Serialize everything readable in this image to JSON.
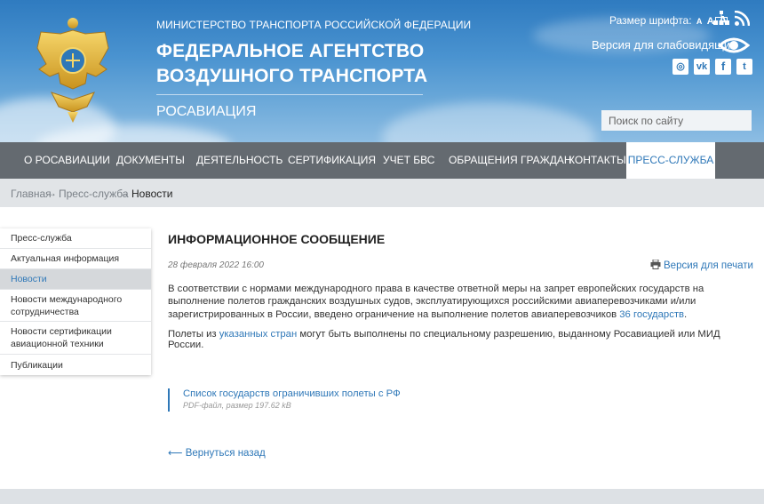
{
  "header": {
    "ministry": "МИНИСТЕРСТВО ТРАНСПОРТА РОССИЙСКОЙ ФЕДЕРАЦИИ",
    "agency_line1": "ФЕДЕРАЛЬНОЕ АГЕНТСТВО",
    "agency_line2": "ВОЗДУШНОГО ТРАНСПОРТА",
    "short_name": "РОСАВИАЦИЯ",
    "font_size_label": "Размер шрифта:",
    "font_size_options": [
      "A",
      "A",
      "A"
    ],
    "blind_version": "Версия для слабовидящих",
    "social": [
      "instagram-icon",
      "vk-icon",
      "facebook-icon",
      "twitter-icon"
    ],
    "search_placeholder": "Поиск по сайту"
  },
  "nav": {
    "items": [
      "О РОСАВИАЦИИ",
      "ДОКУМЕНТЫ",
      "ДЕЯТЕЛЬНОСТЬ",
      "СЕРТИФИКАЦИЯ",
      "УЧЕТ БВС",
      "ОБРАЩЕНИЯ ГРАЖДАН",
      "КОНТАКТЫ",
      "ПРЕСС-СЛУЖБА"
    ],
    "active": "ПРЕСС-СЛУЖБА"
  },
  "breadcrumb": {
    "items": [
      "Главная",
      "Пресс-служба",
      "Новости"
    ],
    "separator": "→"
  },
  "sidebar": {
    "items": [
      "Пресс-служба",
      "Актуальная информация",
      "Новости",
      "Новости международного сотрудничества",
      "Новости сертификации авиационной техники",
      "Публикации"
    ],
    "active": "Новости"
  },
  "article": {
    "title": "ИНФОРМАЦИОННОЕ СООБЩЕНИЕ",
    "date": "28 февраля 2022 16:00",
    "print_label": "Версия для печати",
    "p1_text": "В соответствии с нормами международного права в качестве ответной меры на запрет европейских государств на выполнение полетов гражданских воздушных судов, эксплуатирующихся российскими авиаперевозчиками и/или зарегистрированных в России, введено ограничение на выполнение полетов авиаперевозчиков ",
    "p1_link": "36 государств",
    "p1_end": ".",
    "p2_start": "Полеты из ",
    "p2_link": "указанных стран",
    "p2_end": " могут быть выполнены по специальному разрешению, выданному Росавиацией или МИД России.",
    "file_name": "Список государств ограничивших полеты с РФ",
    "file_meta": "PDF-файл, размер 197.62 kB",
    "back_label": "Вернуться назад",
    "back_arrow": "⟵"
  },
  "colors": {
    "accent": "#2f78b8",
    "nav_bg": "#646a70",
    "breadcrumb_bg": "#e1e4e7"
  }
}
